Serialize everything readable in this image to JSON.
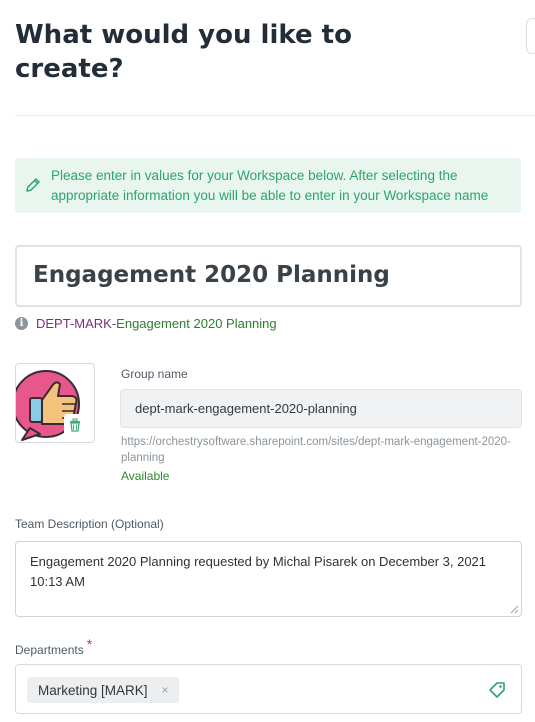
{
  "header": {
    "title": "What would you like to create?"
  },
  "info_banner": {
    "message": "Please enter in values for your Workspace below. After selecting the appropriate information you will be able to enter in your Workspace name",
    "icon": "pencil-icon",
    "color": "#2ea46b"
  },
  "workspace_name": {
    "value": "Engagement 2020 Planning"
  },
  "name_preview": {
    "prefix": "DEPT-MARK-",
    "name": "Engagement 2020 Planning"
  },
  "group": {
    "label": "Group name",
    "value": "dept-mark-engagement-2020-planning",
    "url": "https://orchestrysoftware.sharepoint.com/sites/dept-mark-engagement-2020-planning",
    "status": "Available"
  },
  "description": {
    "label": "Team Description (Optional)",
    "value": "Engagement 2020 Planning requested by Michal Pisarek on December 3, 2021 10:13 AM"
  },
  "departments": {
    "label": "Departments",
    "required_mark": "*",
    "selected": [
      {
        "label": "Marketing [MARK]",
        "remove": "×"
      }
    ]
  }
}
